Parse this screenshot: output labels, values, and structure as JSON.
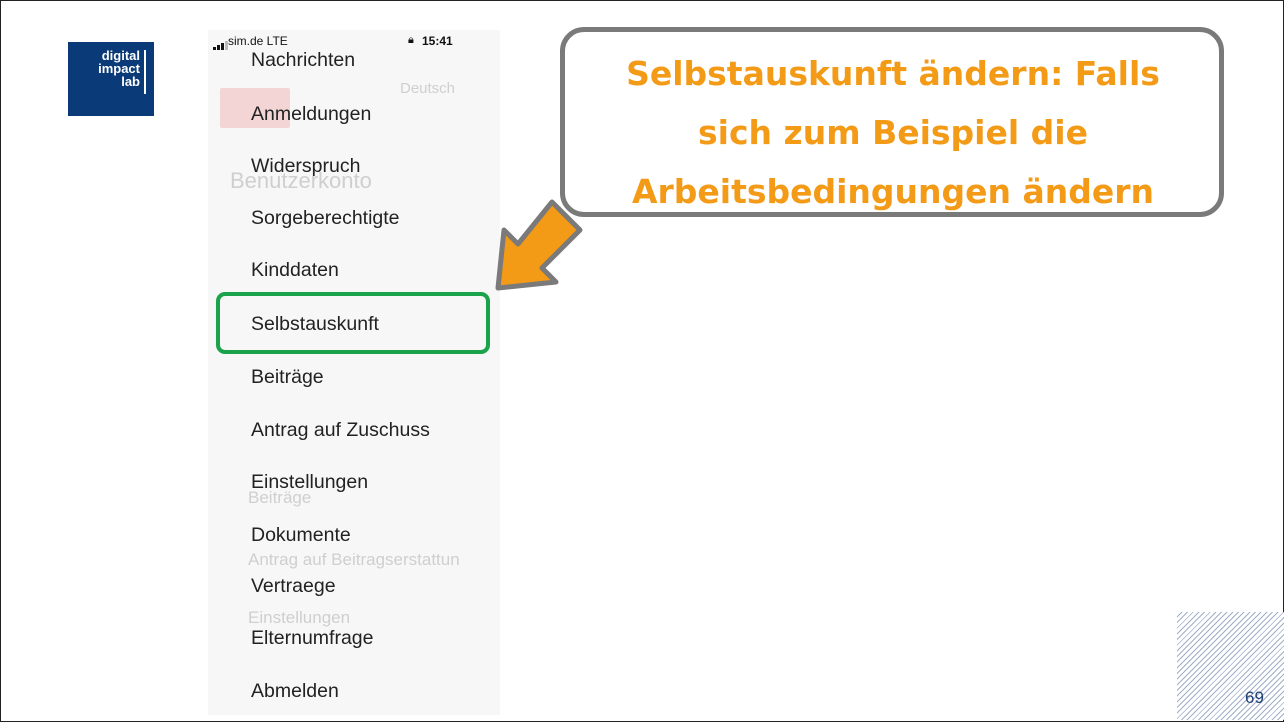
{
  "logo": {
    "line1": "digital",
    "line2": "impact",
    "line3": "lab"
  },
  "status_bar": {
    "carrier": "sim.de  LTE",
    "time": "15:41"
  },
  "background_ghost_text": [
    "Deutsch",
    "Benutzerkonto",
    "Beiträge",
    "Antrag auf Beitragserstattun",
    "Einstellungen"
  ],
  "menu": {
    "items": [
      {
        "label": "Nachrichten"
      },
      {
        "label": "Anmeldungen"
      },
      {
        "label": "Widerspruch"
      },
      {
        "label": "Sorgeberechtigte"
      },
      {
        "label": "Kinddaten"
      },
      {
        "label": "Selbstauskunft",
        "highlighted": true
      },
      {
        "label": "Beiträge"
      },
      {
        "label": "Antrag auf Zuschuss"
      },
      {
        "label": "Einstellungen"
      },
      {
        "label": "Dokumente"
      },
      {
        "label": "Vertraege"
      },
      {
        "label": "Elternumfrage"
      },
      {
        "label": "Abmelden"
      }
    ]
  },
  "callout": {
    "line1": "Selbstauskunft ändern: Falls",
    "line2": "sich zum Beispiel die",
    "line3": "Arbeitsbedingungen ändern"
  },
  "colors": {
    "callout_text": "#f39a17",
    "highlight_border": "#1aa34a",
    "logo_bg": "#0b3a78",
    "arrow": "#f39a17"
  },
  "page_number": "69"
}
